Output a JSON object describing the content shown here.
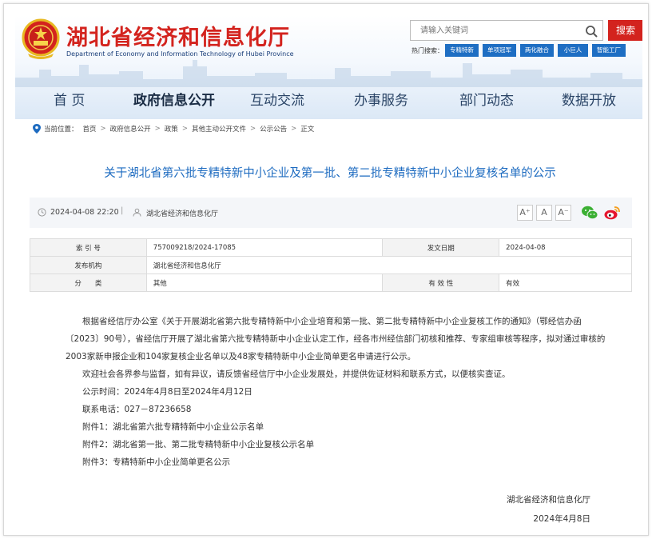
{
  "header": {
    "title": "湖北省经济和信息化厅",
    "subtitle": "Department of Economy and Information Technology of Hubei Province",
    "emblem_icon": "national-emblem-icon",
    "brand_color": "#d3231e",
    "search": {
      "placeholder": "请输入关键词",
      "button_label": "搜索"
    },
    "hot": {
      "label": "热门搜索：",
      "tags": [
        "专精特新",
        "单项冠军",
        "两化融合",
        "小巨人",
        "智能工厂"
      ]
    }
  },
  "nav": {
    "items": [
      "首 页",
      "政府信息公开",
      "互动交流",
      "办事服务",
      "部门动态",
      "数据开放"
    ],
    "active_index": 1
  },
  "breadcrumb": {
    "label": "当前位置：",
    "items": [
      "首页",
      "政府信息公开",
      "政策",
      "其他主动公开文件",
      "公示公告",
      "正文"
    ]
  },
  "article": {
    "title": "关于湖北省第六批专精特新中小企业及第一批、第二批专精特新中小企业复核名单的公示",
    "date": "2024-04-08 22:20",
    "divider": "|",
    "source": "湖北省经济和信息化厅",
    "font_sizes": [
      "A⁺",
      "A",
      "A⁻"
    ],
    "share_icons": [
      "wechat-icon",
      "weibo-icon"
    ]
  },
  "info_table": {
    "rows": [
      {
        "k1": "索 引 号",
        "v1": "757009218/2024-17085",
        "k2": "发文日期",
        "v2": "2024-04-08"
      },
      {
        "k1": "发布机构",
        "v1": "湖北省经济和信息化厅"
      },
      {
        "k1": "分　　类",
        "v1": "其他",
        "k2": "有 效 性",
        "v2": "有效"
      }
    ]
  },
  "body": {
    "paragraphs": [
      "根据省经信厅办公室《关于开展湖北省第六批专精特新中小企业培育和第一批、第二批专精特新中小企业复核工作的通知》（鄂经信办函〔2023〕90号），省经信厅开展了湖北省第六批专精特新中小企业认定工作，经各市州经信部门初核和推荐、专家组审核等程序，拟对通过审核的2003家新申报企业和104家复核企业名单以及48家专精特新中小企业简单更名申请进行公示。",
      "欢迎社会各界参与监督，如有异议，请反馈省经信厅中小企业发展处，并提供佐证材料和联系方式，以便核实查证。",
      "公示时间：2024年4月8日至2024年4月12日",
      "联系电话：027－87236658"
    ],
    "attachments": [
      "附件1：湖北省第六批专精特新中小企业公示名单",
      "附件2：湖北省第一批、第二批专精特新中小企业复核公示名单",
      "附件3：专精特新中小企业简单更名公示"
    ],
    "signature": "湖北省经济和信息化厅",
    "sign_date": "2024年4月8日"
  }
}
